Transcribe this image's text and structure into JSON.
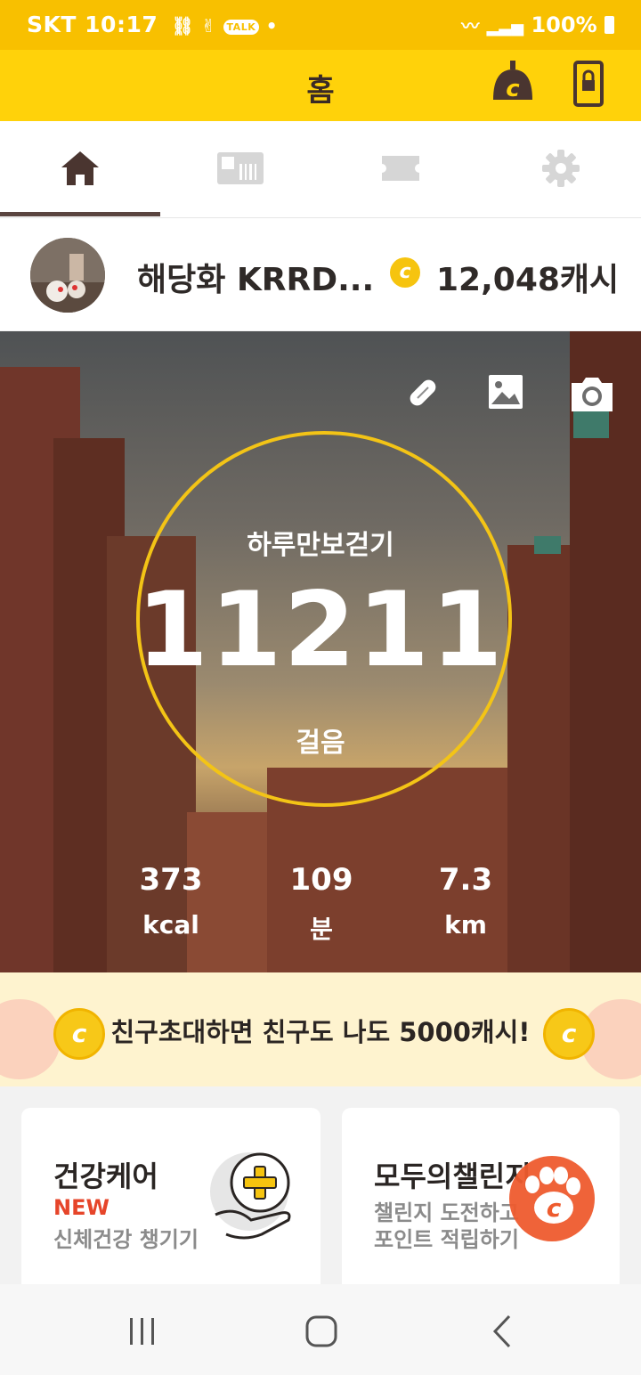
{
  "status_bar": {
    "carrier": "SKT",
    "time": "10:17",
    "battery": "100%"
  },
  "header": {
    "title": "홈"
  },
  "tabs": [
    {
      "icon": "home-icon",
      "active": true
    },
    {
      "icon": "gift-card-icon",
      "active": false
    },
    {
      "icon": "ticket-icon",
      "active": false
    },
    {
      "icon": "gear-icon",
      "active": false
    }
  ],
  "profile": {
    "name": "해당화 KRRD...",
    "coin_symbol": "c",
    "cash": "12,048캐시"
  },
  "hero": {
    "goal_label": "하루만보걷기",
    "steps": "11211",
    "steps_unit": "걸음",
    "stats": [
      {
        "value": "373",
        "unit": "kcal"
      },
      {
        "value": "109",
        "unit": "분"
      },
      {
        "value": "7.3",
        "unit": "km"
      }
    ]
  },
  "banner": {
    "text": "친구초대하면 친구도 나도 5000캐시!",
    "coin_symbol": "c"
  },
  "cards": [
    {
      "title": "건강케어",
      "badge": "NEW",
      "subtitle": "신체건강 챙기기"
    },
    {
      "title": "모두의챌린지",
      "subtitle_line1": "챌린지 도전하고",
      "subtitle_line2": "포인트 적립하기",
      "badge_symbol": "c"
    }
  ],
  "colors": {
    "brand_yellow": "#ffd20a",
    "status_yellow": "#f8c000",
    "coin": "#f6c40f",
    "accent_red": "#e6452a",
    "brown": "#5a4540"
  }
}
